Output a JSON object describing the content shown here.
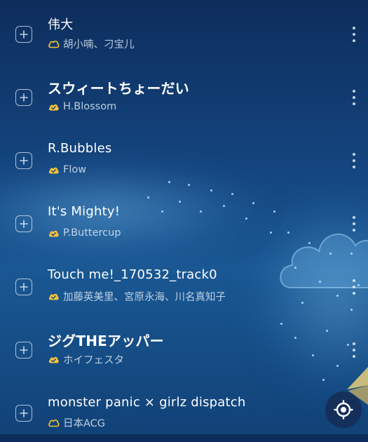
{
  "colors": {
    "background_top": "#0d2d5c",
    "background_bottom": "#114278",
    "badge": "#f2c23c",
    "title_text": "#ffffff",
    "artist_text": "#e1ebf8"
  },
  "songs": [
    {
      "title": "伟大",
      "artist": "胡小喃、刁宝儿",
      "badge_icon": "cloud-icon"
    },
    {
      "title": "スウィートちょーだい",
      "artist": "H.Blossom",
      "badge_icon": "cloud-check-icon"
    },
    {
      "title": "R.Bubbles",
      "artist": "Flow",
      "badge_icon": "cloud-check-icon"
    },
    {
      "title": "It's Mighty!",
      "artist": "P.Buttercup",
      "badge_icon": "cloud-check-icon"
    },
    {
      "title": "Touch me!_170532_track0",
      "artist": "加藤英美里、宮原永海、川名真知子",
      "badge_icon": "cloud-check-icon"
    },
    {
      "title": "ジグTHEアッパー",
      "artist": "ホイフェスタ",
      "badge_icon": "cloud-check-icon"
    },
    {
      "title": "monster panic × girlz dispatch",
      "artist": "日本ACG",
      "badge_icon": "cloud-icon"
    }
  ],
  "icons": {
    "add": "plus-square-icon",
    "more": "more-vertical-icon",
    "locate": "locate-target-icon"
  }
}
